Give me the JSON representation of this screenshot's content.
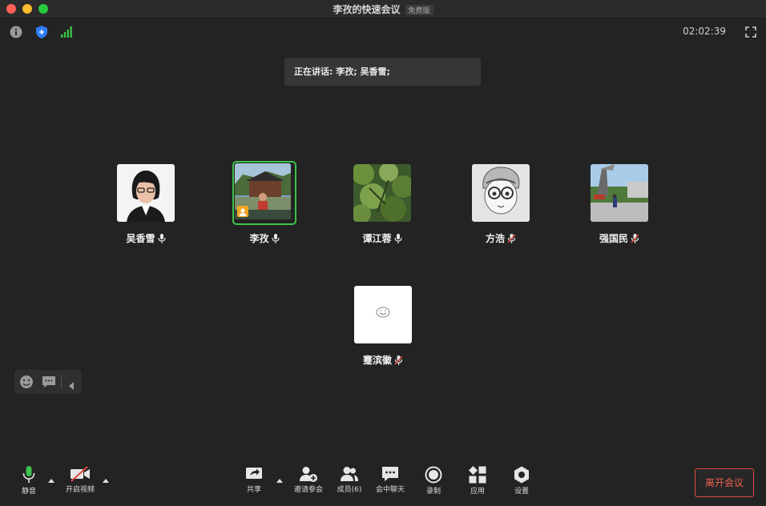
{
  "window": {
    "title": "李孜的快速会议",
    "badge": "免费版"
  },
  "topbar": {
    "timer": "02:02:39"
  },
  "speaking": {
    "text": "正在讲话: 李孜; 吴香雪;"
  },
  "participants": [
    {
      "name": "吴香雪",
      "muted": false
    },
    {
      "name": "李孜",
      "muted": false,
      "active": true,
      "host": true
    },
    {
      "name": "谭江蓉",
      "muted": false
    },
    {
      "name": "方浩",
      "muted": true
    },
    {
      "name": "强国民",
      "muted": true
    },
    {
      "name": "蹇滨徽",
      "muted": true
    }
  ],
  "toolbar": {
    "mute": "静音",
    "video": "开启视频",
    "share": "共享",
    "invite": "邀请参会",
    "members": "成员(6)",
    "chat": "会中聊天",
    "record": "录制",
    "apps": "应用",
    "settings": "设置",
    "leave": "离开会议"
  },
  "colors": {
    "active_speaker": "#3ec14b",
    "leave": "#e04a3f",
    "signal": "#3ec14b",
    "shield": "#2f7df6"
  }
}
